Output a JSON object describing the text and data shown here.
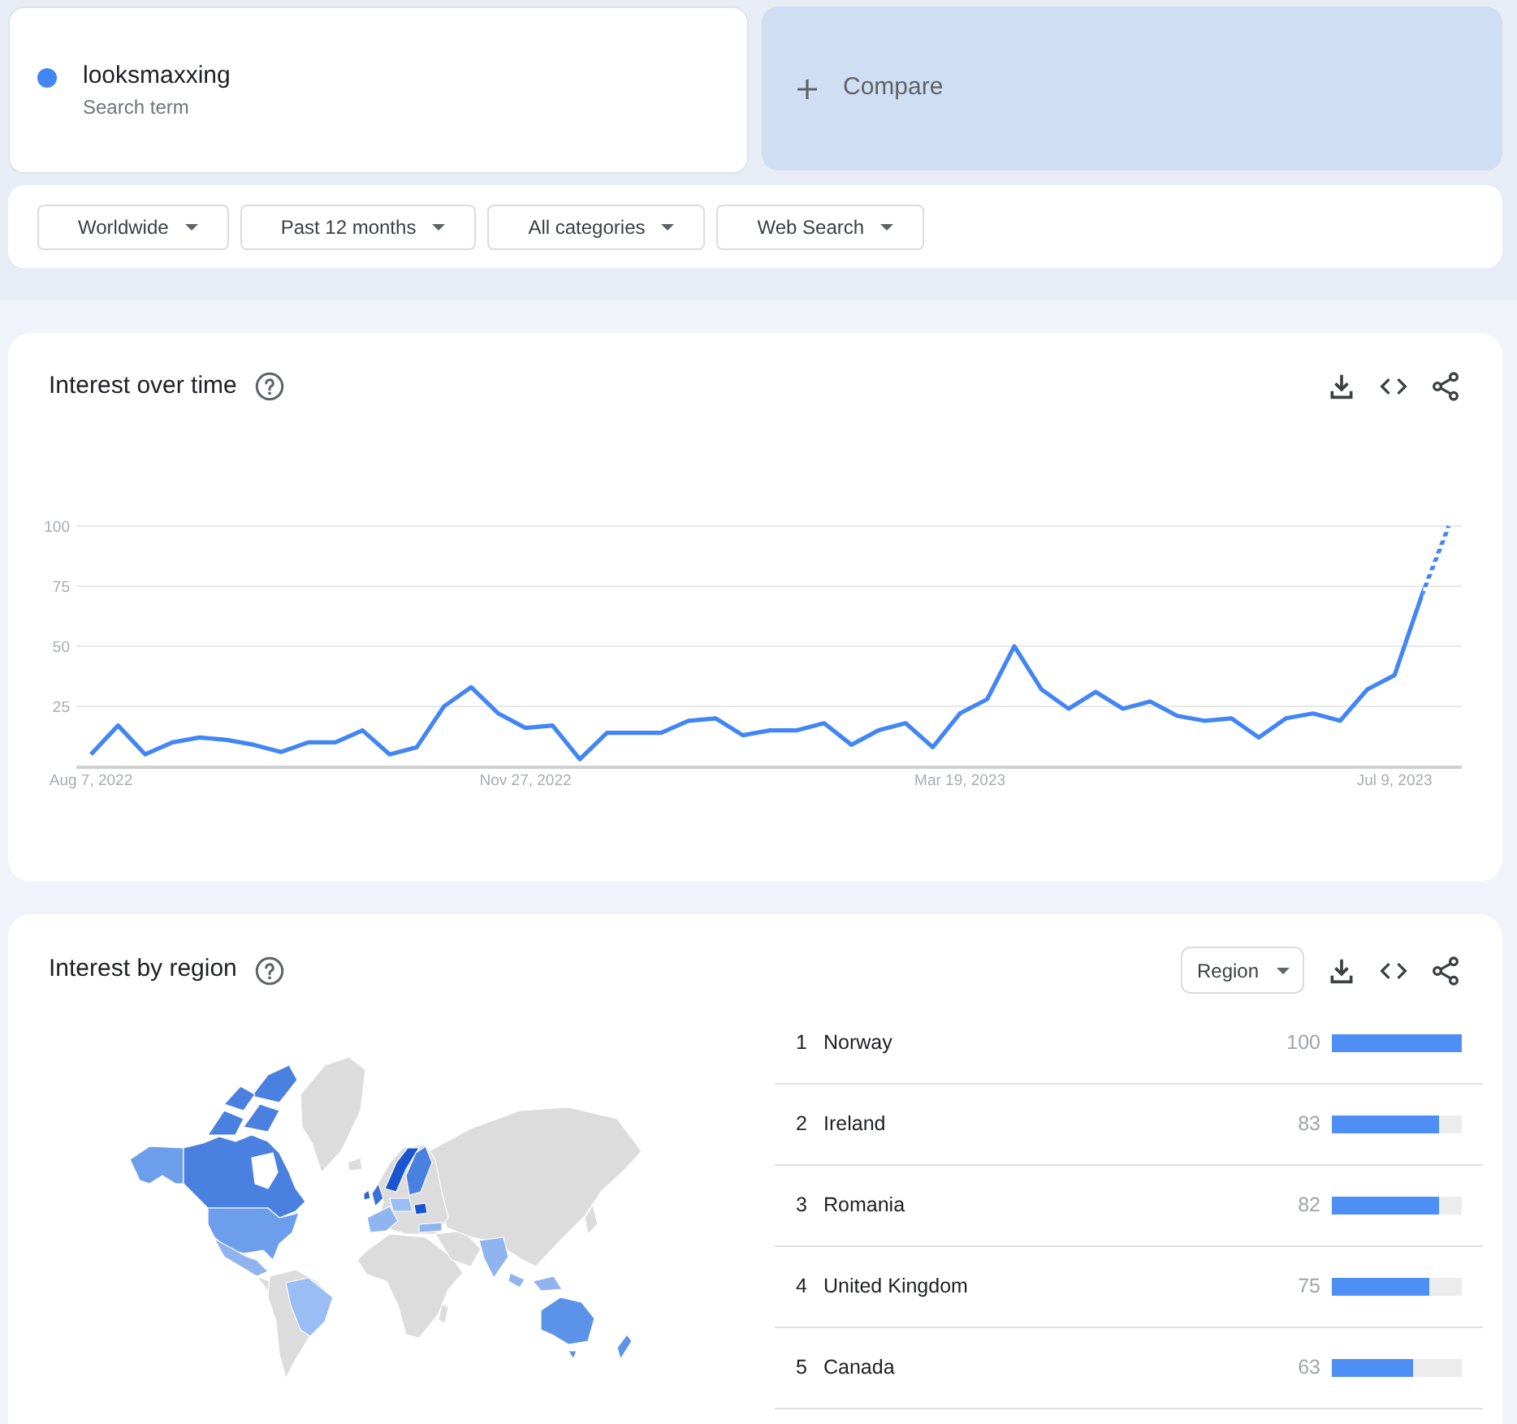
{
  "search_terms": [
    {
      "term": "looksmaxxing",
      "label": "Search term",
      "color": "#4285f4"
    }
  ],
  "compare": {
    "label": "Compare"
  },
  "filters": [
    "Worldwide",
    "Past 12 months",
    "All categories",
    "Web Search"
  ],
  "interest_over_time": {
    "title": "Interest over time",
    "last_point_partial": true,
    "chart_data": {
      "type": "line",
      "grid": true,
      "ylim": [
        0,
        100
      ],
      "yticks": [
        25,
        50,
        75,
        100
      ],
      "categories": [
        "Aug 7, 2022",
        null,
        null,
        null,
        null,
        null,
        null,
        null,
        null,
        null,
        null,
        null,
        null,
        null,
        null,
        null,
        "Nov 27, 2022",
        null,
        null,
        null,
        null,
        null,
        null,
        null,
        null,
        null,
        null,
        null,
        null,
        null,
        null,
        null,
        "Mar 19, 2023",
        null,
        null,
        null,
        null,
        null,
        null,
        null,
        null,
        null,
        null,
        null,
        null,
        null,
        null,
        null,
        "Jul 9, 2023",
        null,
        null
      ],
      "series": [
        {
          "color": "#4285f4",
          "values": [
            5,
            17,
            5,
            10,
            12,
            11,
            9,
            6,
            10,
            10,
            15,
            5,
            8,
            25,
            33,
            22,
            16,
            17,
            3,
            14,
            14,
            14,
            19,
            20,
            13,
            15,
            15,
            18,
            9,
            15,
            18,
            8,
            22,
            28,
            50,
            32,
            24,
            31,
            24,
            27,
            21,
            19,
            20,
            12,
            20,
            22,
            19,
            32,
            38,
            71,
            100
          ]
        }
      ]
    }
  },
  "interest_by_region": {
    "title": "Interest by region",
    "resolution": "Region",
    "regions": [
      {
        "rank": "1",
        "name": "Norway",
        "value": "100",
        "level": 1.0
      },
      {
        "rank": "2",
        "name": "Ireland",
        "value": "83",
        "level": 0.83
      },
      {
        "rank": "3",
        "name": "Romania",
        "value": "82",
        "level": 0.82
      },
      {
        "rank": "4",
        "name": "United Kingdom",
        "value": "75",
        "level": 0.75
      },
      {
        "rank": "5",
        "name": "Canada",
        "value": "63",
        "level": 0.63
      }
    ]
  }
}
